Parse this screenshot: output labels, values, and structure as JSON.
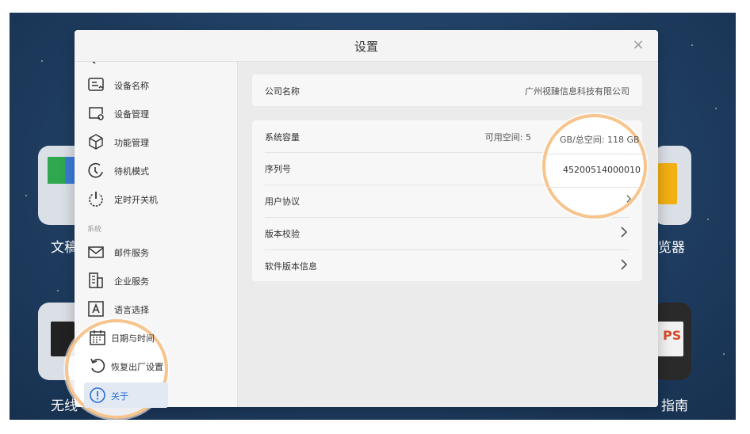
{
  "background": {
    "title": "",
    "apps": [
      {
        "label": "文稿"
      },
      {
        "label": "览器"
      },
      {
        "label": "无线"
      },
      {
        "label": "指南"
      }
    ]
  },
  "dialog": {
    "title": "设置",
    "close_glyph": "×"
  },
  "sidebar": {
    "section_system": "系统",
    "items": [
      {
        "label": "设备名称",
        "icon": "device-name-icon"
      },
      {
        "label": "设备管理",
        "icon": "device-manage-icon"
      },
      {
        "label": "功能管理",
        "icon": "cube-icon"
      },
      {
        "label": "待机模式",
        "icon": "standby-icon"
      },
      {
        "label": "定时开关机",
        "icon": "power-icon"
      },
      {
        "label": "邮件服务",
        "icon": "mail-icon"
      },
      {
        "label": "企业服务",
        "icon": "building-icon"
      },
      {
        "label": "语言选择",
        "icon": "language-icon"
      },
      {
        "label": "日期与时间",
        "icon": "calendar-icon"
      },
      {
        "label": "恢复出厂设置",
        "icon": "restore-icon"
      },
      {
        "label": "关于",
        "icon": "info-icon"
      }
    ]
  },
  "about": {
    "company_label": "公司名称",
    "company_value": "广州视臻信息科技有限公司",
    "capacity_label": "系统容量",
    "capacity_value": "可用空间: 5",
    "capacity_value_mag": "GB/总空间: 118 GB",
    "serial_label": "序列号",
    "serial_value": "45200514000010",
    "agreement_label": "用户协议",
    "version_check_label": "版本校验",
    "software_info_label": "软件版本信息"
  },
  "colors": {
    "accent": "#2a6fd6",
    "highlight": "#f7c48e"
  }
}
